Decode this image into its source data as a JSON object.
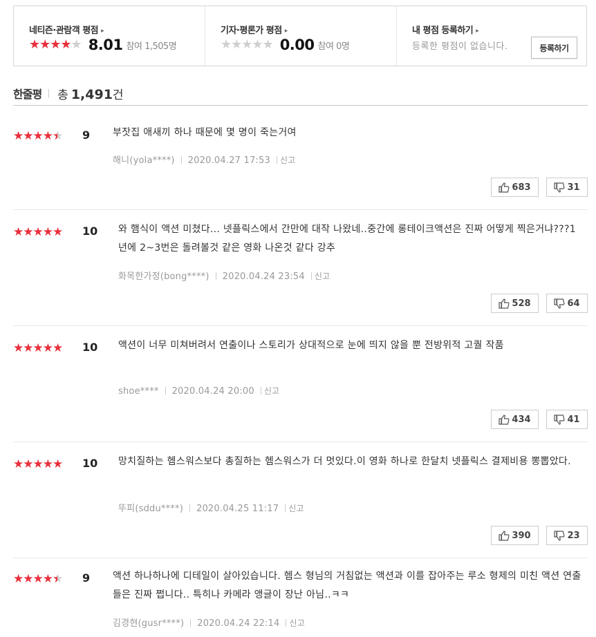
{
  "summary": {
    "netizen": {
      "title": "네티즌·관람객 평점",
      "arrow": "▸",
      "score": "8.01",
      "count": "참여 1,505명",
      "stars_on": 4
    },
    "critic": {
      "title": "기자·평론가 평점",
      "arrow": "▸",
      "score": "0.00",
      "count": "참여 0명",
      "stars_on": 0
    },
    "mine": {
      "title": "내 평점 등록하기",
      "arrow": "▸",
      "empty": "등록한 평점이 없습니다.",
      "button": "등록하기"
    }
  },
  "section": {
    "title": "한줄평",
    "total_prefix": "총",
    "total": "1,491",
    "unit": "건"
  },
  "colors": {
    "star": "#e8303c",
    "star_off": "#cfcfcf"
  },
  "reviews": [
    {
      "rating": 4.5,
      "score": "9",
      "text": "부잣집 애새끼 하나 때문에 몇 명이 죽는거여",
      "user": "해니(yola****)",
      "date": "2020.04.27 17:53",
      "report": "신고",
      "up": "683",
      "down": "31"
    },
    {
      "rating": 5,
      "score": "10",
      "text": "와 햄식이 액션 미쳤다... 넷플릭스에서 간만에 대작 나왔네..중간에 롱테이크액션은 진짜 어떻게 찍은거냐???1년에 2~3번은 돌려볼것 같은 영화 나온것 같다 강추",
      "user": "화목한가정(bong****)",
      "date": "2020.04.24 23:54",
      "report": "신고",
      "up": "528",
      "down": "64"
    },
    {
      "rating": 5,
      "score": "10",
      "text": "액션이 너무 미쳐버려서 연출이나 스토리가 상대적으로 눈에 띄지 않을 뿐 전방위적 고퀄 작품",
      "user": "shoe****",
      "date": "2020.04.24 20:00",
      "report": "신고",
      "up": "434",
      "down": "41"
    },
    {
      "rating": 5,
      "score": "10",
      "text": "망치질하는 헴스워스보다 총질하는 헴스워스가 더 멋있다.이 영화 하나로 한달치 넷플릭스 결제비용 뽕뽑았다.",
      "user": "뚜피(sddu****)",
      "date": "2020.04.25 11:17",
      "report": "신고",
      "up": "390",
      "down": "23"
    },
    {
      "rating": 4.5,
      "score": "9",
      "text": "액션 하나하나에 디테일이 살아있습니다. 헴스 형님의 거침없는 액션과 이를 잡아주는 루소 형제의 미친 액션 연출들은 진짜 쩝니다.. 특히나 카메라 앵글이 장난 아님..ㅋㅋ",
      "user": "김경현(gusr****)",
      "date": "2020.04.24 22:14",
      "report": "신고",
      "up": "",
      "down": ""
    }
  ]
}
